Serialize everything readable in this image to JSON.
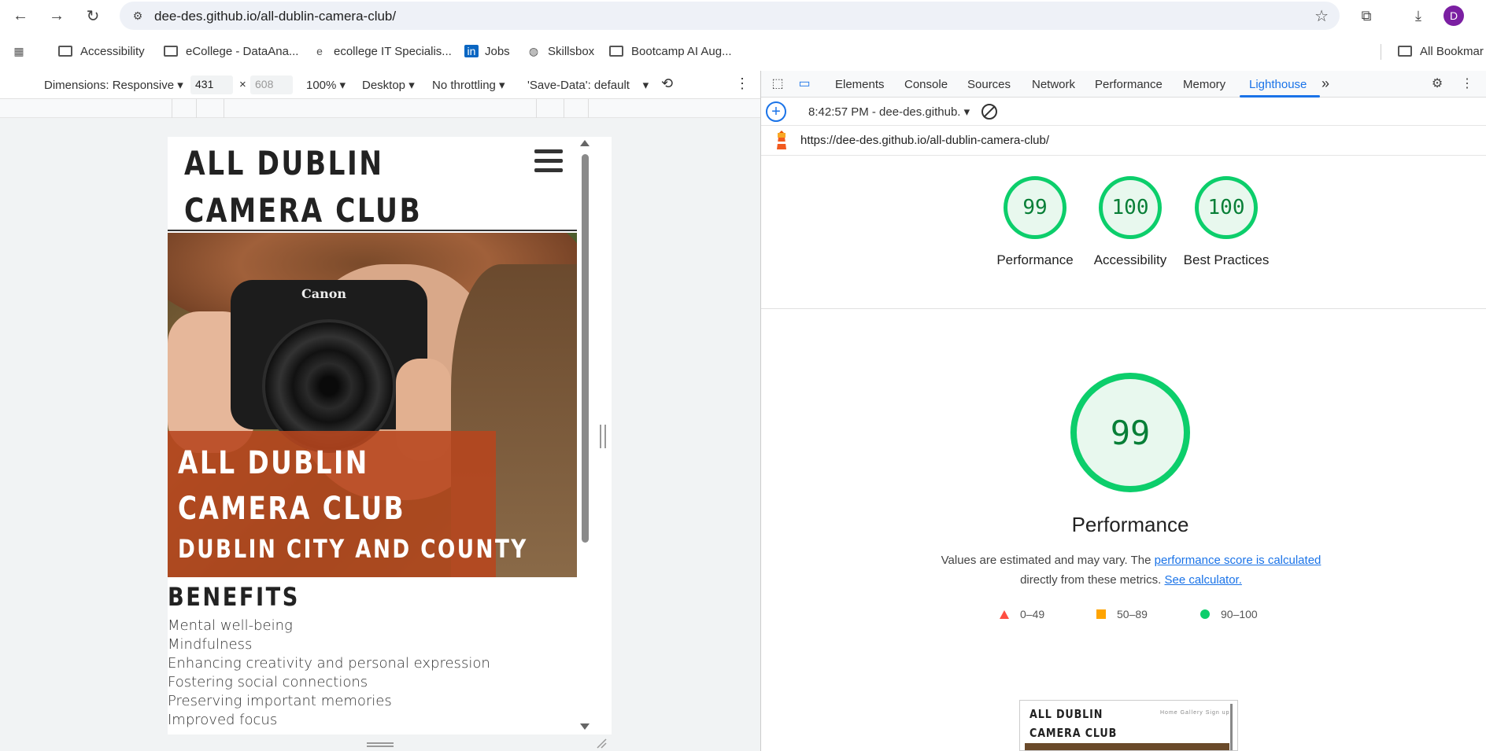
{
  "browser": {
    "url": "dee-des.github.io/all-dublin-camera-club/",
    "avatar_letter": "D",
    "bookmarks": [
      "Accessibility",
      "eCollege - DataAna...",
      "ecollege IT Specialis...",
      "Jobs",
      "Skillsbox",
      "Bootcamp AI Aug...",
      "All Bookmar"
    ]
  },
  "device_toolbar": {
    "dimensions_label": "Dimensions: Responsive",
    "width_value": "431",
    "times": "×",
    "height_placeholder": "608",
    "zoom": "100%",
    "device_type": "Desktop",
    "throttling": "No throttling",
    "save_data": "'Save-Data': default"
  },
  "site": {
    "title": "ALL DUBLIN CAMERA CLUB",
    "camera_brand": "Canon",
    "hero_title": "ALL DUBLIN CAMERA CLUB",
    "hero_subtitle": "DUBLIN CITY AND COUNTY",
    "benefits_title": "BENEFITS",
    "benefits": [
      "Mental well-being",
      "Mindfulness",
      "Enhancing creativity and personal expression",
      "Fostering social connections",
      "Preserving important memories",
      "Improved focus"
    ]
  },
  "devtools": {
    "tabs": [
      "Elements",
      "Console",
      "Sources",
      "Network",
      "Performance",
      "Memory",
      "Lighthouse"
    ],
    "active_tab": "Lighthouse",
    "more_tabs": "»",
    "report_select": "8:42:57 PM - dee-des.github.",
    "report_url": "https://dee-des.github.io/all-dublin-camera-club/",
    "scores": [
      {
        "label": "Performance",
        "value": "99"
      },
      {
        "label": "Accessibility",
        "value": "100"
      },
      {
        "label": "Best Practices",
        "value": "100"
      }
    ],
    "main_score": "99",
    "main_label": "Performance",
    "note_text": "Values are estimated and may vary. The",
    "note_link1": "performance score is calculated",
    "note_text2": "directly from these metrics.",
    "note_link2": "See calculator.",
    "legend": [
      "0–49",
      "50–89",
      "90–100"
    ],
    "thumb_title": "ALL DUBLIN CAMERA CLUB",
    "thumb_nav": "Home  Gallery  Sign up",
    "colors": {
      "pass": "#0cce6b",
      "average": "#ffa400",
      "fail": "#ff4e42",
      "accent": "#1a73e8"
    }
  }
}
